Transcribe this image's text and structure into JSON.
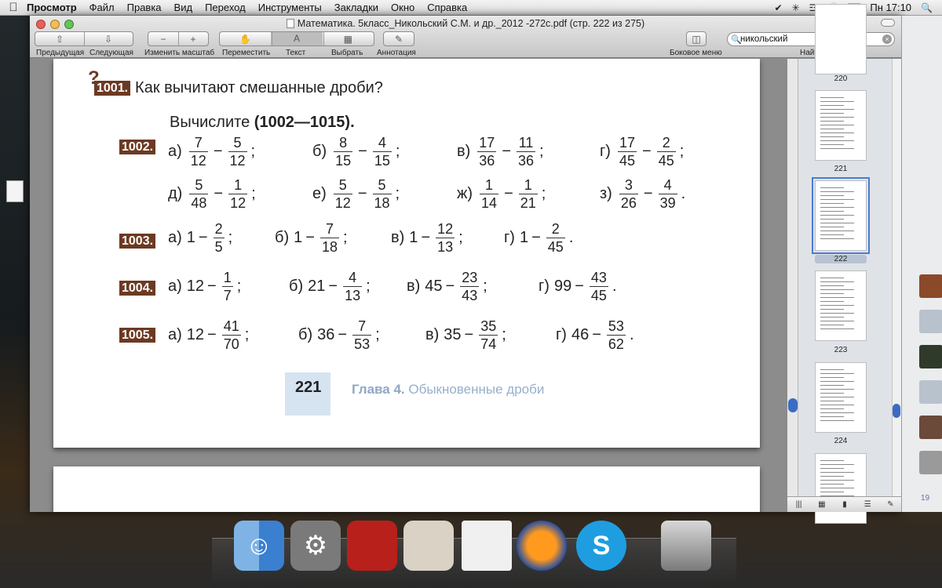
{
  "menubar": {
    "app_name": "Просмотр",
    "items": [
      "Файл",
      "Правка",
      "Вид",
      "Переход",
      "Инструменты",
      "Закладки",
      "Окно",
      "Справка"
    ],
    "clock": "Пн 17:10"
  },
  "window": {
    "title": "Математика. 5класс_Никольский С.М. и др._2012 -272с.pdf (стр. 222 из 275)"
  },
  "toolbar": {
    "prev_label": "Предыдущая",
    "next_label": "Следующая",
    "zoom_label": "Изменить масштаб",
    "move_label": "Переместить",
    "text_label": "Текст",
    "select_label": "Выбрать",
    "annot_label": "Аннотация",
    "sidebar_label": "Боковое меню",
    "find_label": "Найти",
    "search_value": "никольский"
  },
  "page": {
    "q1001_num": "1001.",
    "q1001_text": "Как вычитают смешанные дроби?",
    "instruction_prefix": "Вычислите",
    "instruction_range": "(1002—1015).",
    "rows": {
      "r1002_num": "1002.",
      "r1003_num": "1003.",
      "r1004_num": "1004.",
      "r1005_num": "1005."
    },
    "footer_page": "221",
    "footer_chapter": "Глава 4.",
    "footer_title": "Обыкновенные дроби"
  },
  "problems": {
    "p1002": [
      {
        "label": "а)",
        "a": [
          "7",
          "12"
        ],
        "b": [
          "5",
          "12"
        ],
        "end": ";"
      },
      {
        "label": "б)",
        "a": [
          "8",
          "15"
        ],
        "b": [
          "4",
          "15"
        ],
        "end": ";"
      },
      {
        "label": "в)",
        "a": [
          "17",
          "36"
        ],
        "b": [
          "11",
          "36"
        ],
        "end": ";"
      },
      {
        "label": "г)",
        "a": [
          "17",
          "45"
        ],
        "b": [
          "2",
          "45"
        ],
        "end": ";"
      },
      {
        "label": "д)",
        "a": [
          "5",
          "48"
        ],
        "b": [
          "1",
          "12"
        ],
        "end": ";"
      },
      {
        "label": "е)",
        "a": [
          "5",
          "12"
        ],
        "b": [
          "5",
          "18"
        ],
        "end": ";"
      },
      {
        "label": "ж)",
        "a": [
          "1",
          "14"
        ],
        "b": [
          "1",
          "21"
        ],
        "end": ";"
      },
      {
        "label": "з)",
        "a": [
          "3",
          "26"
        ],
        "b": [
          "4",
          "39"
        ],
        "end": "."
      }
    ],
    "p1003": [
      {
        "label": "а)",
        "w": "1",
        "b": [
          "2",
          "5"
        ],
        "end": ";"
      },
      {
        "label": "б)",
        "w": "1",
        "b": [
          "7",
          "18"
        ],
        "end": ";"
      },
      {
        "label": "в)",
        "w": "1",
        "b": [
          "12",
          "13"
        ],
        "end": ";"
      },
      {
        "label": "г)",
        "w": "1",
        "b": [
          "2",
          "45"
        ],
        "end": "."
      }
    ],
    "p1004": [
      {
        "label": "а)",
        "w": "12",
        "b": [
          "1",
          "7"
        ],
        "end": ";"
      },
      {
        "label": "б)",
        "w": "21",
        "b": [
          "4",
          "13"
        ],
        "end": ";"
      },
      {
        "label": "в)",
        "w": "45",
        "b": [
          "23",
          "43"
        ],
        "end": ";"
      },
      {
        "label": "г)",
        "w": "99",
        "b": [
          "43",
          "45"
        ],
        "end": "."
      }
    ],
    "p1005": [
      {
        "label": "а)",
        "w": "12",
        "b": [
          "41",
          "70"
        ],
        "end": ";"
      },
      {
        "label": "б)",
        "w": "36",
        "b": [
          "7",
          "53"
        ],
        "end": ";"
      },
      {
        "label": "в)",
        "w": "35",
        "b": [
          "35",
          "74"
        ],
        "end": ";"
      },
      {
        "label": "г)",
        "w": "46",
        "b": [
          "53",
          "62"
        ],
        "end": "."
      }
    ]
  },
  "sidebar": {
    "pages": [
      "220",
      "221",
      "222",
      "223",
      "224"
    ],
    "selected": "222"
  },
  "right_strip": {
    "count": "19"
  },
  "colors": {
    "accent": "#3a6cc4",
    "tag": "#6b3a22",
    "footer_blue": "#8fa7c4"
  }
}
